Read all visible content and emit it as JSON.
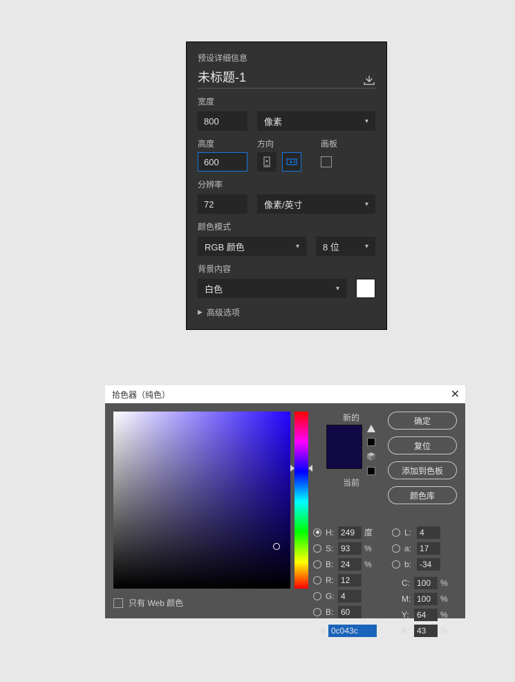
{
  "preset": {
    "section_label": "预设详细信息",
    "doc_title": "未标题-1",
    "width_label": "宽度",
    "width_value": "800",
    "width_unit": "像素",
    "height_label": "高度",
    "height_value": "600",
    "orientation_label": "方向",
    "artboard_label": "画板",
    "resolution_label": "分辨率",
    "resolution_value": "72",
    "resolution_unit": "像素/英寸",
    "colormode_label": "颜色模式",
    "colormode_value": "RGB 颜色",
    "bitdepth_value": "8 位",
    "bgcontent_label": "背景内容",
    "bgcontent_value": "白色",
    "advanced_label": "高级选项"
  },
  "picker": {
    "title": "拾色器（纯色）",
    "new_label": "新的",
    "current_label": "当前",
    "ok": "确定",
    "reset": "复位",
    "add_swatch": "添加到色板",
    "color_lib": "颜色库",
    "web_only": "只有 Web 颜色",
    "new_color": "#110946",
    "current_color": "#110946",
    "H": {
      "label": "H:",
      "value": "249",
      "unit": "度"
    },
    "S": {
      "label": "S:",
      "value": "93",
      "unit": "%"
    },
    "Bv": {
      "label": "B:",
      "value": "24",
      "unit": "%"
    },
    "R": {
      "label": "R:",
      "value": "12"
    },
    "G": {
      "label": "G:",
      "value": "4"
    },
    "B": {
      "label": "B:",
      "value": "60"
    },
    "L": {
      "label": "L:",
      "value": "4"
    },
    "a": {
      "label": "a:",
      "value": "17"
    },
    "b": {
      "label": "b:",
      "value": "-34"
    },
    "C": {
      "label": "C:",
      "value": "100",
      "unit": "%"
    },
    "M": {
      "label": "M:",
      "value": "100",
      "unit": "%"
    },
    "Y": {
      "label": "Y:",
      "value": "64",
      "unit": "%"
    },
    "K": {
      "label": "K:",
      "value": "43",
      "unit": "%"
    },
    "hex_label": "#",
    "hex_value": "0c043c",
    "sv_cursor": {
      "x_pct": 92,
      "y_pct": 76
    },
    "hue_ptr_pct": 32
  }
}
